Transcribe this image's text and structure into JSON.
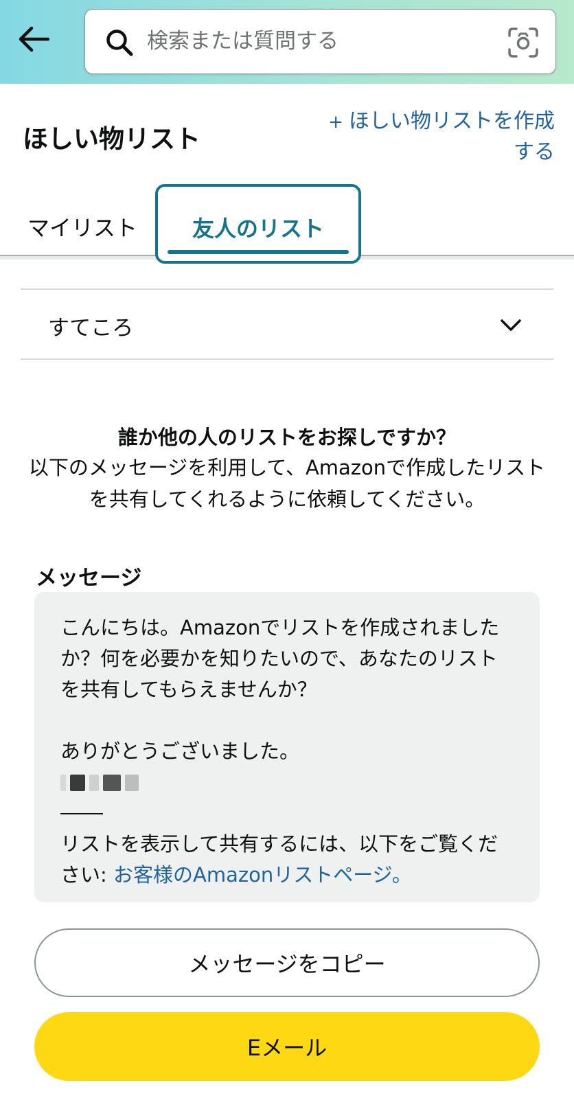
{
  "header": {
    "back_icon": "arrow-left-icon",
    "search_placeholder": "検索または質問する",
    "search_icon": "search-icon",
    "camera_icon": "camera-scan-icon",
    "gradient_colors": [
      "#84d8e3",
      "#b7e9cc"
    ]
  },
  "page": {
    "title": "ほしい物リスト",
    "create_list_plus": "+",
    "create_list_label": "ほしい物リストを作成する"
  },
  "tabs": [
    {
      "label": "マイリスト",
      "selected": false
    },
    {
      "label": "友人のリスト",
      "selected": true
    }
  ],
  "dropdown": {
    "selected": "すてころ"
  },
  "info": {
    "heading": "誰か他の人のリストをお探しですか？",
    "body": "以下のメッセージを利用して、Amazonで作成したリストを共有してくれるように依頼してください。"
  },
  "message": {
    "label": "メッセージ",
    "paragraph1": "こんにちは。Amazonでリストを作成されましたか？何を必要かを知りたいので、あなたのリストを共有してもらえませんか？",
    "paragraph2": "ありがとうございました。",
    "paragraph3": "リストを表示して共有するには、以下をご覧ください: ",
    "link": "お客様のAmazonリストページ。"
  },
  "buttons": {
    "copy": "メッセージをコピー",
    "email": "Eメール"
  },
  "colors": {
    "accent": "#16738c",
    "link": "#2162a1",
    "email_button": "#ffd814",
    "message_bg": "#eff1f1"
  }
}
